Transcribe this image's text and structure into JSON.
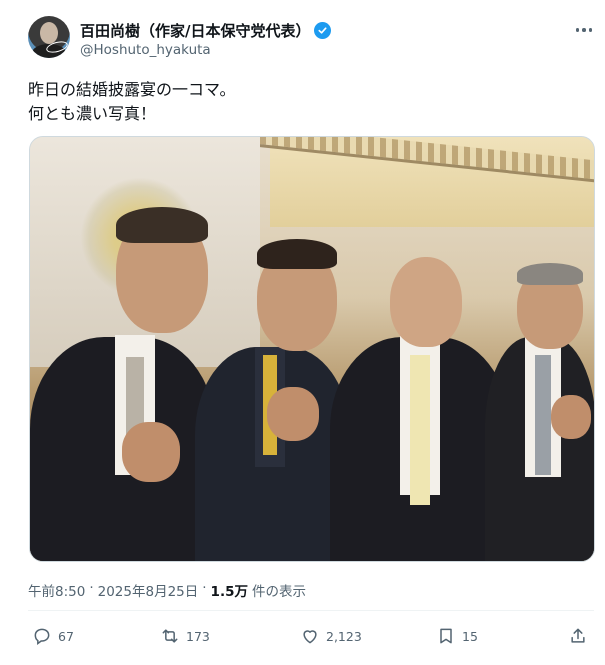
{
  "author": {
    "display_name": "百田尚樹（作家/日本保守党代表）",
    "handle": "@Hoshuto_hyakuta",
    "verified": true,
    "avatar_icon": "author-avatar"
  },
  "menu_icon": "more-icon",
  "tweet": {
    "lines": [
      "昨日の結婚披露宴の一コマ。",
      "何とも濃い写真！"
    ]
  },
  "photo": {
    "description_icon": "wedding-photo"
  },
  "meta": {
    "time": "午前8:50",
    "date": "2025年8月25日",
    "separator": "·",
    "views": "1.5万",
    "views_label": "件の表示"
  },
  "actions": {
    "replies": "67",
    "retweets": "173",
    "likes": "2,123",
    "bookmarks": "15"
  },
  "colors": {
    "verified": "#1d9bf0",
    "secondary_text": "#536471",
    "primary_text": "#0f1419"
  }
}
